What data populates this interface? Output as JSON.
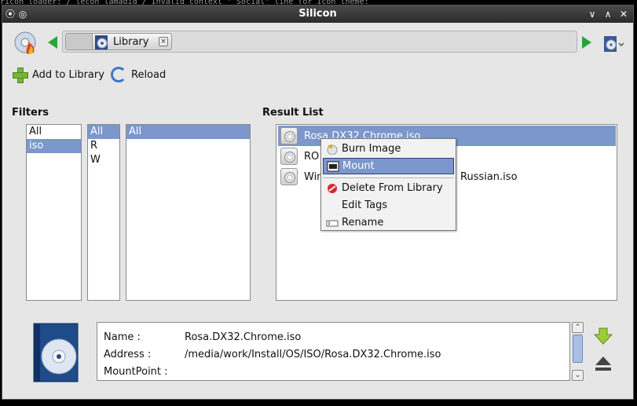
{
  "window": {
    "title": "Silicon"
  },
  "background": {
    "top_terminal_text": "ricon loader: / lecon lamadid / Invalid context \" Social\" line for icon theme:",
    "bottom_terminal_text": ""
  },
  "navbar": {
    "breadcrumb_label": "Library",
    "icons": [
      "app-logo-icon",
      "back-arrow-icon",
      "forward-arrow-icon",
      "disc-menu-icon"
    ]
  },
  "toolbar": {
    "add_label": "Add to Library",
    "reload_label": "Reload"
  },
  "filters": {
    "title": "Filters",
    "col1": [
      "All",
      "iso"
    ],
    "col1_selected": 1,
    "col2": [
      "All",
      "R",
      "W"
    ],
    "col2_selected": 0,
    "col3": [
      "All"
    ],
    "col3_selected": 0
  },
  "results": {
    "title": "Result List",
    "rows": [
      {
        "text": "Rosa.DX32.Chrome.iso",
        "selected": true
      },
      {
        "text": "RO",
        "selected": false
      },
      {
        "text": "Win",
        "suffix": "Russian.iso",
        "selected": false
      }
    ]
  },
  "context_menu": {
    "items": [
      {
        "label": "Burn Image",
        "icon": "burn-icon"
      },
      {
        "label": "Mount",
        "icon": "mount-icon",
        "highlighted": true
      },
      {
        "label": "Delete From Library",
        "icon": "delete-icon"
      },
      {
        "label": "Edit Tags",
        "icon": ""
      },
      {
        "label": "Rename",
        "icon": "rename-icon"
      }
    ]
  },
  "details": {
    "name_key": "Name :",
    "name_val": "Rosa.DX32.Chrome.iso",
    "address_key": "Address :",
    "address_val": "/media/work/Install/OS/ISO/Rosa.DX32.Chrome.iso",
    "mount_key": "MountPoint :",
    "mount_val": ""
  },
  "colors": {
    "selection": "#7b97cc",
    "window_bg": "#e6e6e6",
    "titlebar": "#2b2b2b",
    "nav_arrow": "#2aa43a"
  }
}
